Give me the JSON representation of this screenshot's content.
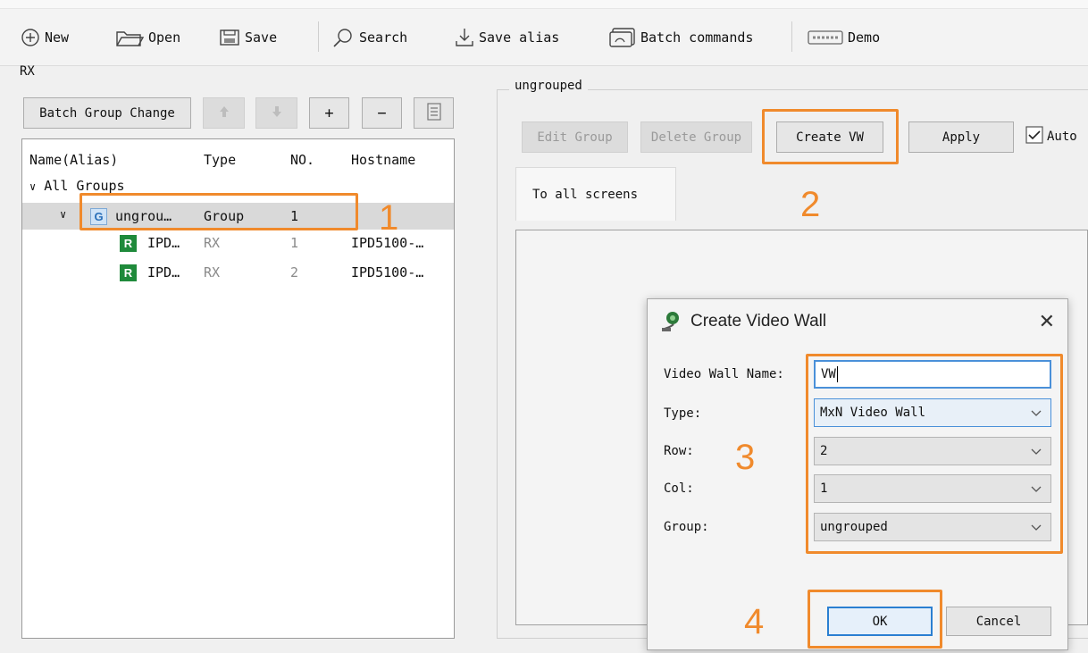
{
  "toolbar": {
    "new_label": "New",
    "open_label": "Open",
    "save_label": "Save",
    "search_label": "Search",
    "save_alias_label": "Save alias",
    "batch_commands_label": "Batch commands",
    "demo_label": "Demo"
  },
  "left_panel": {
    "title": "RX",
    "batch_group_change_label": "Batch Group Change",
    "add_label": "+",
    "remove_label": "−",
    "tree": {
      "columns": [
        "Name(Alias)",
        "Type",
        "NO.",
        "Hostname"
      ],
      "root_label": "All Groups",
      "group_row": {
        "badge": "G",
        "name": "ungrou…",
        "type": "Group",
        "no": "1"
      },
      "device_rows": [
        {
          "badge": "R",
          "name": "IPD…",
          "type": "RX",
          "no": "1",
          "hostname": "IPD5100-…"
        },
        {
          "badge": "R",
          "name": "IPD…",
          "type": "RX",
          "no": "2",
          "hostname": "IPD5100-…"
        }
      ]
    }
  },
  "right_panel": {
    "group_title": "ungrouped",
    "edit_group_label": "Edit Group",
    "delete_group_label": "Delete Group",
    "create_vw_label": "Create VW",
    "apply_label": "Apply",
    "auto_label": "Auto",
    "auto_checked": true,
    "screens_tab_label": "To all screens"
  },
  "dialog": {
    "title": "Create Video Wall",
    "close_glyph": "✕",
    "video_wall_name_label": "Video Wall Name:",
    "video_wall_name_value": "VW",
    "type_label": "Type:",
    "type_value": "MxN Video Wall",
    "row_label": "Row:",
    "row_value": "2",
    "col_label": "Col:",
    "col_value": "1",
    "group_label": "Group:",
    "group_value": "ungrouped",
    "ok_label": "OK",
    "cancel_label": "Cancel"
  },
  "annotations": {
    "step1": "1",
    "step2": "2",
    "step3": "3",
    "step4": "4",
    "color": "#f08a2c"
  }
}
